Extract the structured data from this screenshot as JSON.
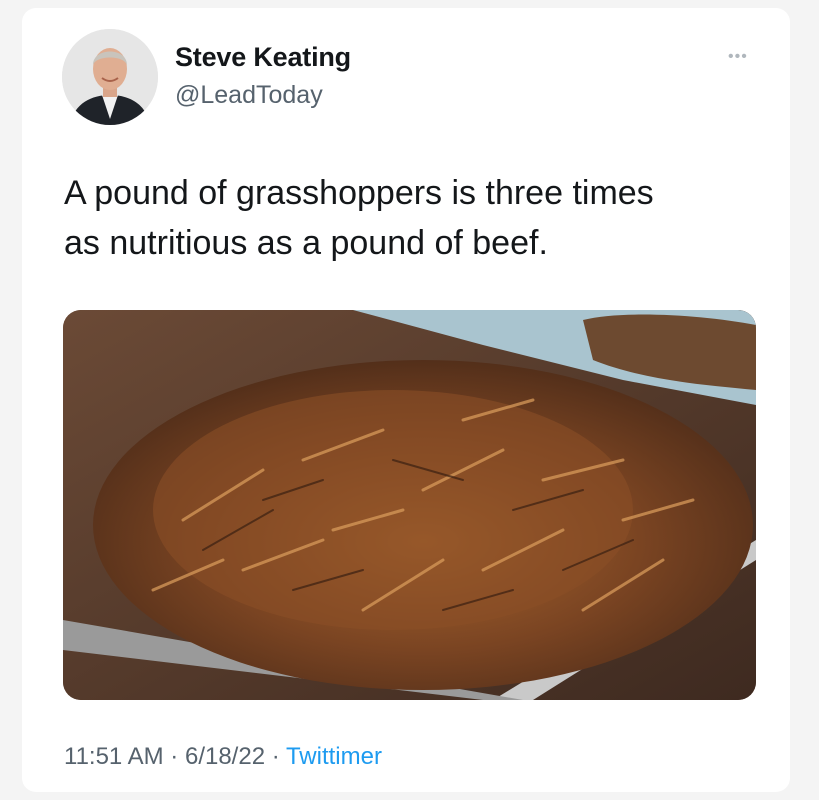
{
  "author": {
    "display_name": "Steve Keating",
    "handle": "@LeadToday"
  },
  "tweet": {
    "text_line1": "A pound of grasshoppers is three times",
    "text_line2": "as nutritious as a pound of beef."
  },
  "footer": {
    "time": "11:51 AM",
    "separator": "·",
    "date": "6/18/22",
    "source": "Twittimer"
  },
  "icons": {
    "more": "more-dots-icon",
    "avatar": "profile-photo",
    "media": "fried-grasshoppers-photo"
  },
  "colors": {
    "link": "#1d9bf0",
    "secondary_text": "#56626d",
    "primary_text": "#14171a"
  }
}
